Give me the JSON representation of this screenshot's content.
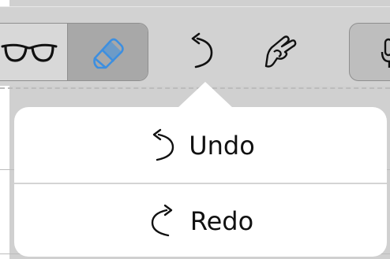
{
  "toolbar": {
    "tools": [
      {
        "name": "glasses",
        "icon": "glasses-icon",
        "selected": false
      },
      {
        "name": "eraser",
        "icon": "eraser-icon",
        "selected": true
      },
      {
        "name": "undo",
        "icon": "undo-icon"
      },
      {
        "name": "markup",
        "icon": "hand-pen-icon"
      },
      {
        "name": "microphone",
        "icon": "microphone-icon"
      }
    ]
  },
  "menu": {
    "items": [
      {
        "label": "Undo",
        "icon": "undo-icon"
      },
      {
        "label": "Redo",
        "icon": "redo-icon"
      }
    ]
  },
  "colors": {
    "accent": "#3d8fe0",
    "toolbar_bg": "#d2d2d2",
    "selected_segment": "#a8a8a8",
    "popover_bg": "#ffffff"
  }
}
